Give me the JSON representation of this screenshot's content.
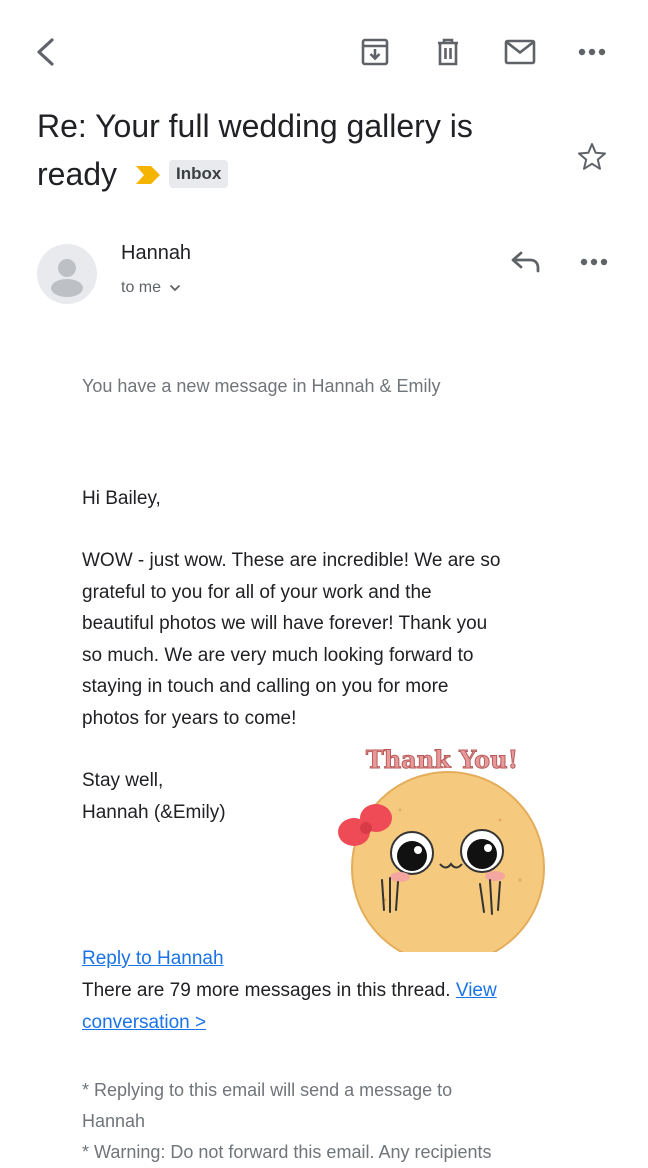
{
  "toolbar": {
    "icons": [
      "back-icon",
      "archive-icon",
      "delete-icon",
      "mark-unread-icon",
      "more-icon"
    ]
  },
  "subject": {
    "line1": "Re: Your full wedding gallery is",
    "line2": "ready",
    "label": "Inbox",
    "importance_color": "#f4b400"
  },
  "sender": {
    "name": "Hannah",
    "recipient": "to me"
  },
  "message": {
    "notice": "You have a new message in Hannah & Emily",
    "greeting": "Hi Bailey,",
    "paragraph_lines": [
      "WOW - just wow. These are incredible! We are so",
      "grateful to you for all of your work and the",
      "beautiful photos we will have forever! Thank you",
      "so much. We are very much looking forward to",
      "staying in touch and calling on you for more",
      "photos for years to come!"
    ],
    "signoff": "Stay well,",
    "signature": "Hannah (&Emily)",
    "sticker_text": "Thank You!",
    "reply_link": "Reply to Hannah",
    "thread_text": "There are 79 more messages in this thread.",
    "view_link_part1": "View",
    "view_link_part2": "conversation >",
    "footer_line1": "* Replying to this email will send a message to",
    "footer_line2": "Hannah",
    "footer_line3": "* Warning: Do not forward this email. Any recipients"
  },
  "colors": {
    "link": "#1a73e8",
    "muted": "#70757a"
  }
}
